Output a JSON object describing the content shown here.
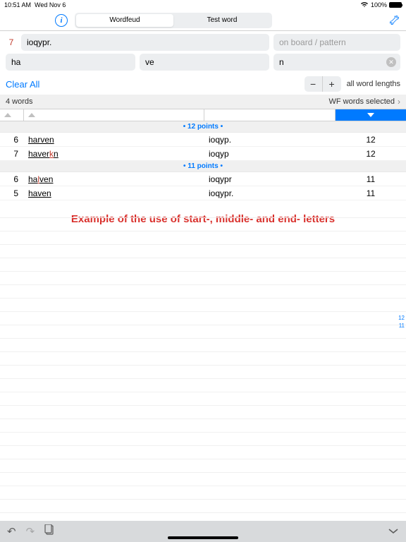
{
  "status": {
    "time": "10:51 AM",
    "date": "Wed Nov 6",
    "battery": "100%"
  },
  "nav": {
    "tab1": "Wordfeud",
    "tab2": "Test word"
  },
  "inputs": {
    "count": "7",
    "rack": "ioqypr.",
    "pattern_placeholder": "on board / pattern",
    "start": "ha",
    "mid": "ve",
    "end": "n"
  },
  "actions": {
    "clear": "Clear All",
    "length": "all word lengths"
  },
  "stepper": {
    "minus": "−",
    "plus": "+"
  },
  "summary": {
    "count": "4 words",
    "selection": "WF words selected"
  },
  "sections": [
    {
      "header": "• 12 points •",
      "rows": [
        {
          "len": "6",
          "word": "harven",
          "rest": "ioqyp.",
          "pts": "12"
        },
        {
          "len": "7",
          "word_pre": "haver",
          "word_red": "k",
          "word_post": "n",
          "rest": "ioqyp",
          "pts": "12"
        }
      ]
    },
    {
      "header": "• 11 points •",
      "rows": [
        {
          "len": "6",
          "word_pre": "ha",
          "word_red": "l",
          "word_post": "ven",
          "rest": "ioqypr",
          "pts": "11"
        },
        {
          "len": "5",
          "word": "haven",
          "rest": "ioqypr.",
          "pts": "11"
        }
      ]
    }
  ],
  "example": "Example of the use of start-, middle- and end- letters",
  "sidemarks": {
    "a": "12",
    "b": "11"
  }
}
